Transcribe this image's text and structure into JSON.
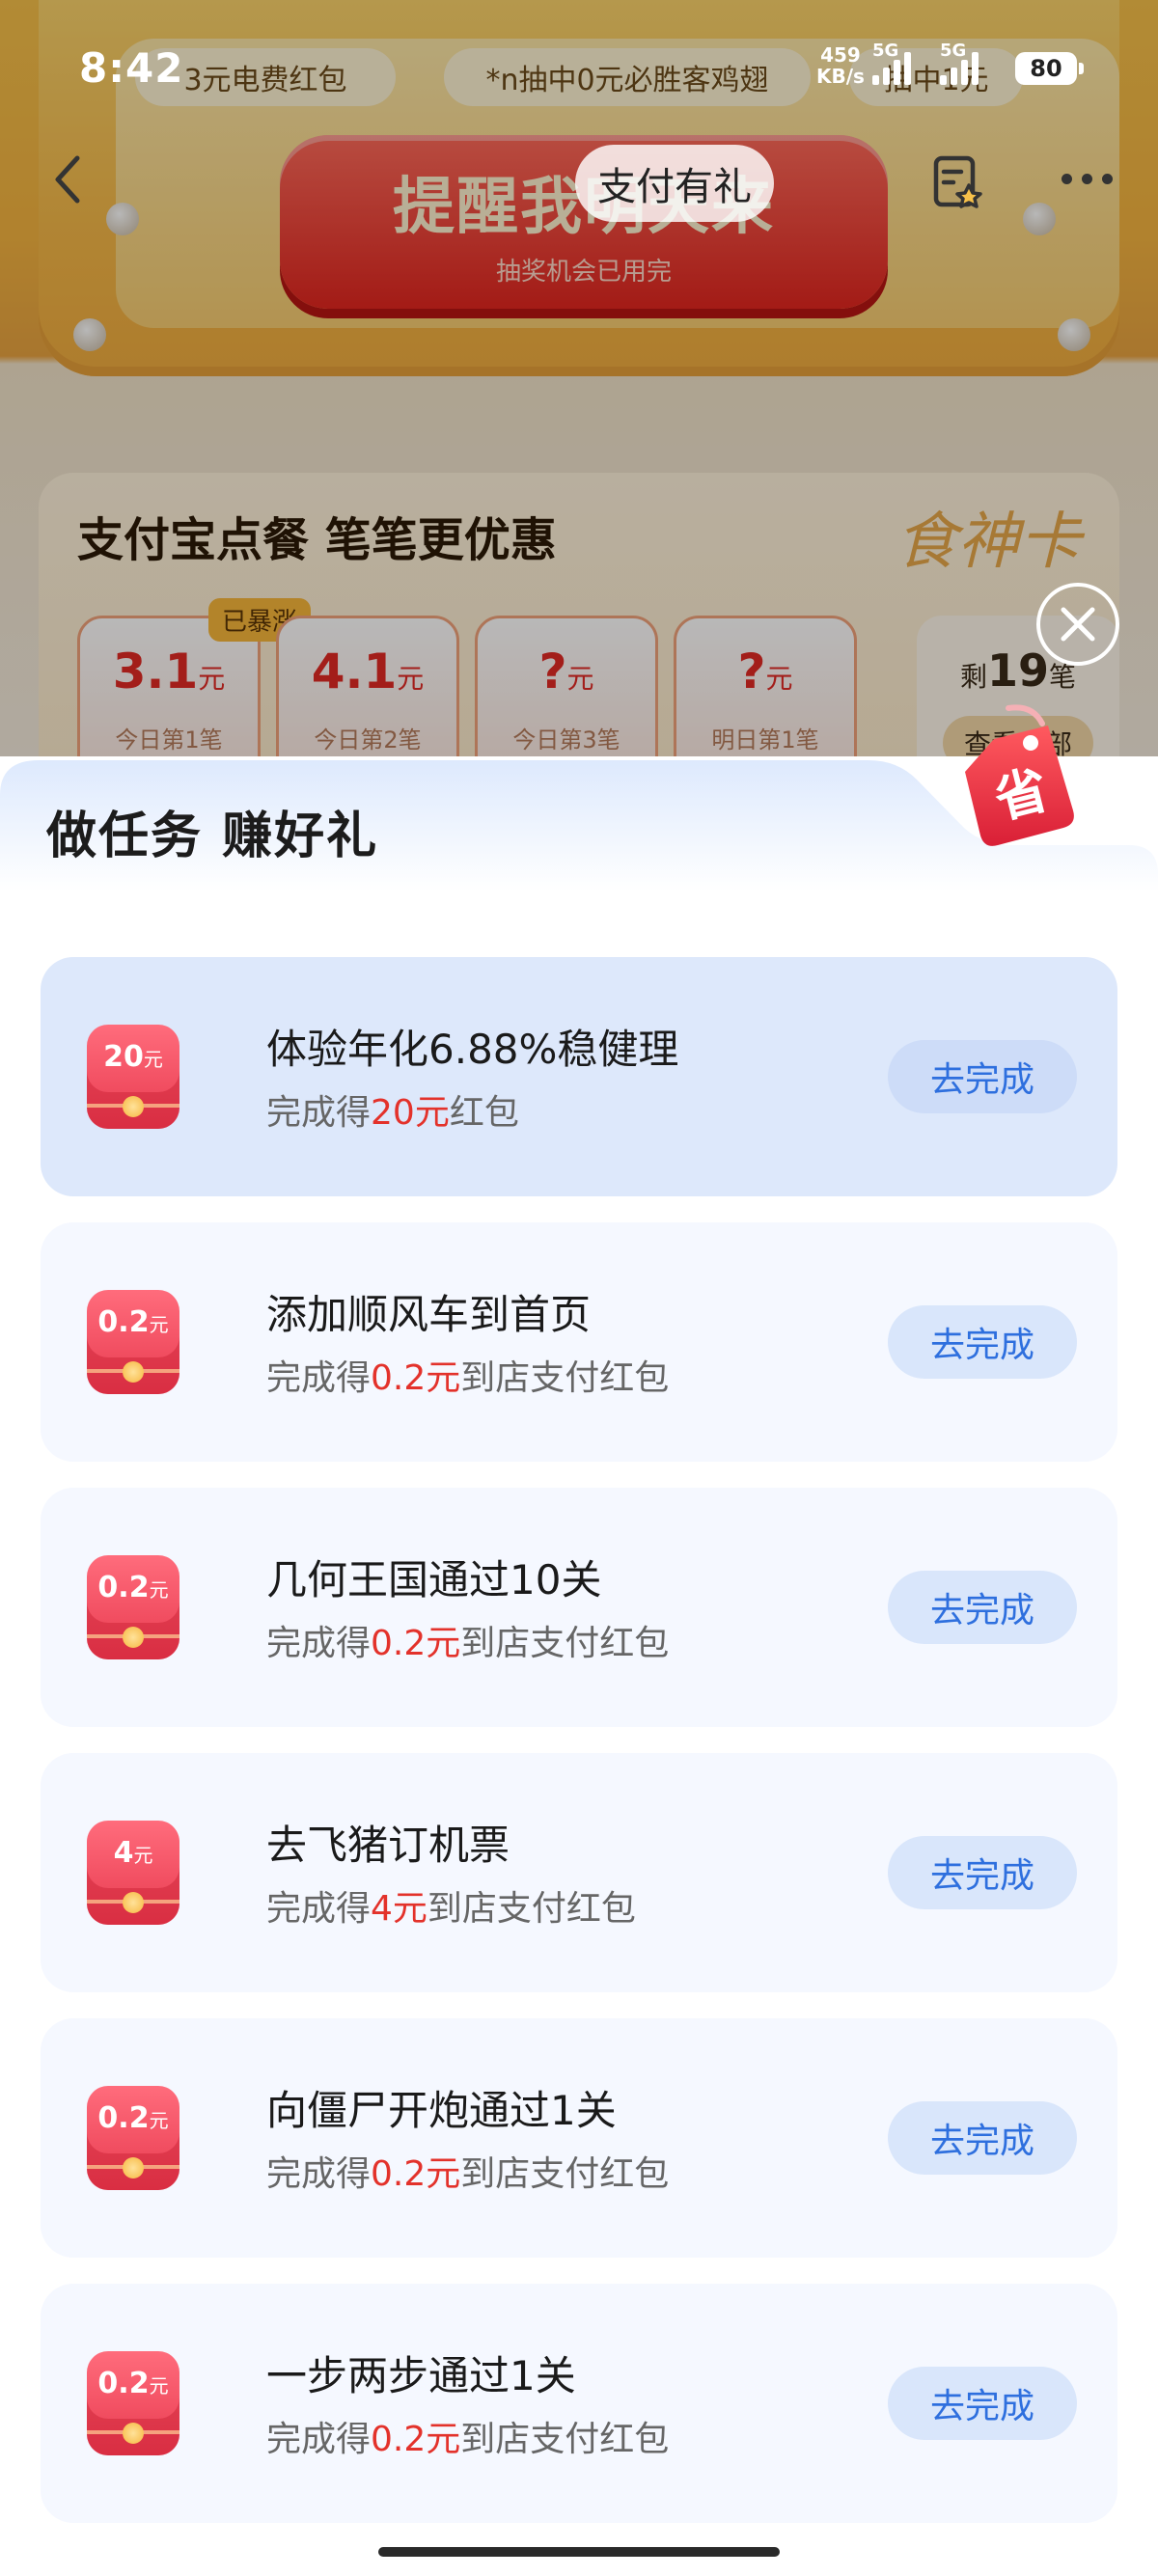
{
  "status_bar": {
    "time": "8:42",
    "net_speed": "459",
    "net_unit": "KB/s",
    "sig1_label": "5G",
    "sig2_label": "5G",
    "battery": "80"
  },
  "background": {
    "promo_pill_1": "3元电费红包",
    "promo_pill_2": "*n抽中0元必胜客鸡翅",
    "promo_pill_3": "抽中1元",
    "red_button_title": "提醒我明天来",
    "red_button_sub": "抽奖机会已用完",
    "card_title": "支付宝点餐 笔笔更优惠",
    "card_brand": "食神卡",
    "card_badge": "已暴涨",
    "slots": [
      {
        "value": "3.1",
        "unit": "元",
        "sub": "今日第1笔"
      },
      {
        "value": "4.1",
        "unit": "元",
        "sub": "今日第2笔"
      },
      {
        "value": "?",
        "unit": "元",
        "sub": "今日第3笔"
      },
      {
        "value": "?",
        "unit": "元",
        "sub": "明日第1笔"
      }
    ],
    "remain_prefix": "剩",
    "remain_count": "19",
    "remain_suffix": "笔",
    "remain_button": "查看全部"
  },
  "nav": {
    "title": "支付有礼"
  },
  "sheet": {
    "title": "做任务 赚好礼",
    "save_tag": "省",
    "tasks": [
      {
        "badge": "20",
        "badge_unit": "元",
        "title": "体验年化6.88%稳健理",
        "reward_prefix": "完成得",
        "reward_amount": "20元",
        "reward_suffix": "红包",
        "button": "去完成"
      },
      {
        "badge": "0.2",
        "badge_unit": "元",
        "title": "添加顺风车到首页",
        "reward_prefix": "完成得",
        "reward_amount": "0.2元",
        "reward_suffix": "到店支付红包",
        "button": "去完成"
      },
      {
        "badge": "0.2",
        "badge_unit": "元",
        "title": "几何王国通过10关",
        "reward_prefix": "完成得",
        "reward_amount": "0.2元",
        "reward_suffix": "到店支付红包",
        "button": "去完成"
      },
      {
        "badge": "4",
        "badge_unit": "元",
        "title": "去飞猪订机票",
        "reward_prefix": "完成得",
        "reward_amount": "4元",
        "reward_suffix": "到店支付红包",
        "button": "去完成"
      },
      {
        "badge": "0.2",
        "badge_unit": "元",
        "title": "向僵尸开炮通过1关",
        "reward_prefix": "完成得",
        "reward_amount": "0.2元",
        "reward_suffix": "到店支付红包",
        "button": "去完成"
      },
      {
        "badge": "0.2",
        "badge_unit": "元",
        "title": "一步两步通过1关",
        "reward_prefix": "完成得",
        "reward_amount": "0.2元",
        "reward_suffix": "到店支付红包",
        "button": "去完成"
      }
    ]
  },
  "colors": {
    "accent_blue": "#2e6fde",
    "reward_red": "#e3322b",
    "highlight_row": "#dde8fb"
  },
  "icons": {
    "back": "chevron-left-icon",
    "favorite": "favorite-icon",
    "more": "more-dots-icon",
    "close": "close-icon"
  }
}
